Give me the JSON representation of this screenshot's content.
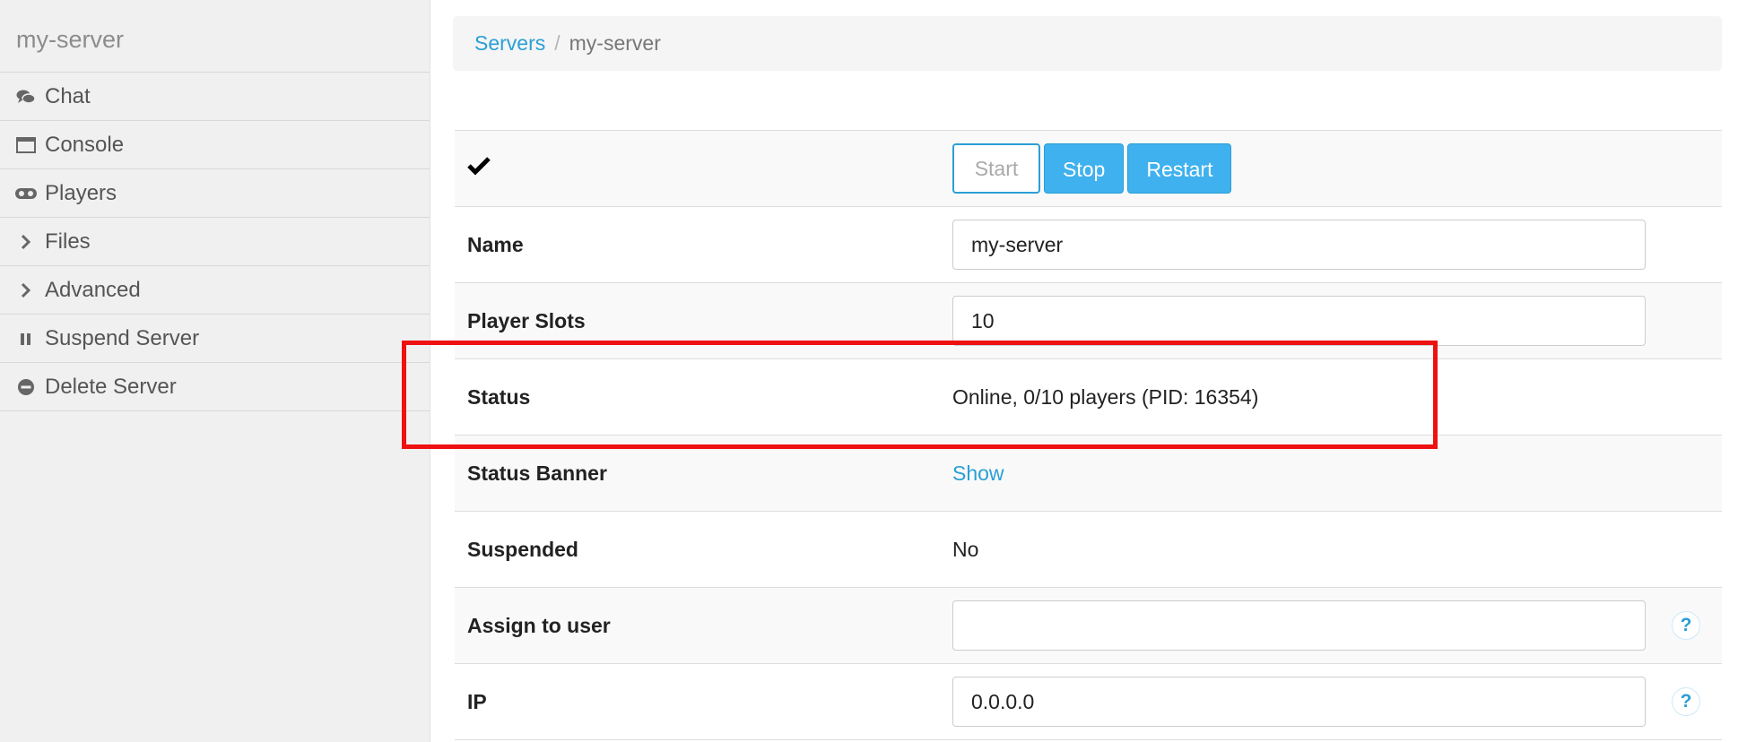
{
  "sidebar": {
    "title": "my-server",
    "items": [
      {
        "label": "Chat",
        "icon": "chat-icon"
      },
      {
        "label": "Console",
        "icon": "console-icon"
      },
      {
        "label": "Players",
        "icon": "gamepad-icon"
      },
      {
        "label": "Files",
        "icon": "chevron-right-icon"
      },
      {
        "label": "Advanced",
        "icon": "chevron-right-icon"
      },
      {
        "label": "Suspend Server",
        "icon": "pause-icon"
      },
      {
        "label": "Delete Server",
        "icon": "minus-circle-icon"
      }
    ]
  },
  "breadcrumb": {
    "parent": "Servers",
    "separator": "/",
    "current": "my-server"
  },
  "controls": {
    "status_icon": "checkmark-icon",
    "start_label": "Start",
    "stop_label": "Stop",
    "restart_label": "Restart"
  },
  "fields": {
    "name": {
      "label": "Name",
      "value": "my-server"
    },
    "player_slots": {
      "label": "Player Slots",
      "value": "10"
    },
    "status": {
      "label": "Status",
      "value": "Online, 0/10 players (PID: 16354)"
    },
    "status_banner": {
      "label": "Status Banner",
      "link": "Show"
    },
    "suspended": {
      "label": "Suspended",
      "value": "No"
    },
    "assign_user": {
      "label": "Assign to user",
      "value": ""
    },
    "ip": {
      "label": "IP",
      "value": "0.0.0.0"
    }
  },
  "help_icon_glyph": "?",
  "colors": {
    "accent": "#2a9fd6",
    "button_fill": "#3fb1ee",
    "highlight": "#ee1111",
    "sidebar_bg": "#f0f0f0"
  }
}
